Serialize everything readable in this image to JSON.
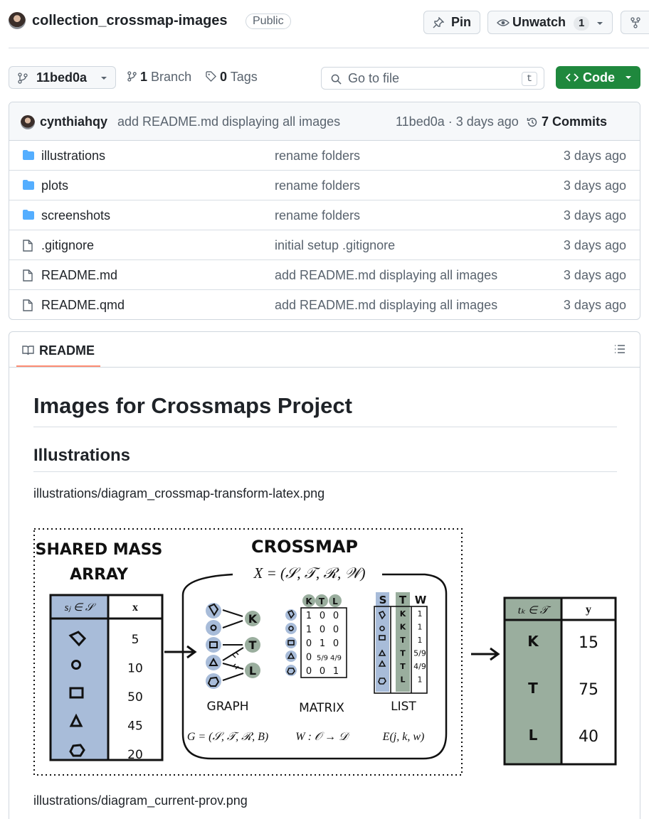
{
  "header": {
    "repo_name": "collection_crossmap-images",
    "visibility": "Public",
    "pin_label": "Pin",
    "unwatch_label": "Unwatch",
    "watch_count": "1"
  },
  "toolbar": {
    "branch_ref": "11bed0a",
    "branch_count": "1",
    "branch_label": "Branch",
    "tag_count": "0",
    "tag_label": "Tags",
    "search_placeholder": "Go to file",
    "search_shortcut": "t",
    "code_label": "Code"
  },
  "latest_commit": {
    "author": "cynthiahqy",
    "message": "add README.md displaying all images",
    "meta": "11bed0a · 3 days ago",
    "commit_count": "7 Commits"
  },
  "files": [
    {
      "type": "folder",
      "name": "illustrations",
      "message": "rename folders",
      "age": "3 days ago"
    },
    {
      "type": "folder",
      "name": "plots",
      "message": "rename folders",
      "age": "3 days ago"
    },
    {
      "type": "folder",
      "name": "screenshots",
      "message": "rename folders",
      "age": "3 days ago"
    },
    {
      "type": "file",
      "name": ".gitignore",
      "message": "initial setup .gitignore",
      "age": "3 days ago"
    },
    {
      "type": "file",
      "name": "README.md",
      "message": "add README.md displaying all images",
      "age": "3 days ago"
    },
    {
      "type": "file",
      "name": "README.qmd",
      "message": "add README.md displaying all images",
      "age": "3 days ago"
    }
  ],
  "readme": {
    "tab_label": "README",
    "h1": "Images for Crossmaps Project",
    "h2": "Illustrations",
    "image1_caption": "illustrations/diagram_crossmap-transform-latex.png",
    "image2_caption": "illustrations/diagram_current-prov.png"
  },
  "diagram": {
    "left_title_1": "SHARED MASS",
    "left_title_2": "ARRAY",
    "left_col_header": "sⱼ ∈ 𝒮",
    "left_val_header": "x",
    "left_values": [
      "5",
      "10",
      "50",
      "45",
      "20"
    ],
    "crossmap_title": "CROSSMAP",
    "crossmap_formula": "X = (𝒮, 𝒯, ℛ, 𝒲)",
    "graph_label": "GRAPH",
    "matrix_label": "MATRIX",
    "list_label": "LIST",
    "graph_formula": "G = (𝒮, 𝒯, ℛ, B)",
    "matrix_formula": "W : 𝒪 → 𝒟",
    "list_formula": "E(j, k, w)",
    "targets": [
      "K",
      "T",
      "L"
    ],
    "matrix_rows": [
      [
        "1",
        "0",
        "0"
      ],
      [
        "1",
        "0",
        "0"
      ],
      [
        "0",
        "1",
        "0"
      ],
      [
        "0",
        "5/9",
        "4/9"
      ],
      [
        "0",
        "0",
        "1"
      ]
    ],
    "list_header_w": "W",
    "list_k_col": [
      "K",
      "K",
      "T",
      "T",
      "T",
      "L"
    ],
    "list_w_col": [
      "1",
      "1",
      "1",
      "5/9",
      "4/9",
      "1"
    ],
    "right_col_header": "tₖ ∈ 𝒯",
    "right_val_header": "y",
    "right_values": [
      "15",
      "75",
      "40"
    ],
    "colors": {
      "source": "#a8bcd9",
      "target": "#9aae9e",
      "ink": "#111111"
    }
  }
}
